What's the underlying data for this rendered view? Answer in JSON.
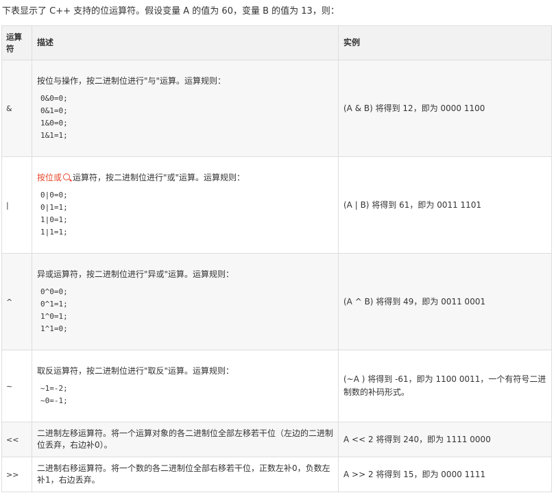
{
  "intro": "下表显示了 C++ 支持的位运算符。假设变量 A 的值为 60，变量 B 的值为 13，则：",
  "headers": {
    "operator": "运算符",
    "description": "描述",
    "example": "实例"
  },
  "rows": [
    {
      "operator": "&",
      "description": "按位与操作，按二进制位进行\"与\"运算。运算规则：",
      "rules": [
        "0&0=0;",
        "0&1=0;",
        "1&0=0;",
        "1&1=1;"
      ],
      "example": "(A & B) 将得到 12，即为 0000 1100"
    },
    {
      "operator": "|",
      "link_text": "按位或",
      "description": "运算符，按二进制位进行\"或\"运算。运算规则：",
      "rules": [
        "0|0=0;",
        "0|1=1;",
        "1|0=1;",
        "1|1=1;"
      ],
      "example": "(A | B) 将得到 61，即为 0011 1101"
    },
    {
      "operator": "^",
      "description": "异或运算符，按二进制位进行\"异或\"运算。运算规则：",
      "rules": [
        "0^0=0;",
        "0^1=1;",
        "1^0=1;",
        "1^1=0;"
      ],
      "example": "(A ^ B) 将得到 49，即为 0011 0001"
    },
    {
      "operator": "~",
      "description": "取反运算符，按二进制位进行\"取反\"运算。运算规则：",
      "rules": [
        "~1=-2;",
        "~0=-1;"
      ],
      "example": "(~A ) 将得到 -61，即为 1100 0011，一个有符号二进制数的补码形式。"
    },
    {
      "operator": "<<",
      "description": "二进制左移运算符。将一个运算对象的各二进制位全部左移若干位（左边的二进制位丢弃，右边补0）。",
      "example": "A << 2 将得到 240，即为 1111 0000"
    },
    {
      "operator": ">>",
      "description": "二进制右移运算符。将一个数的各二进制位全部右移若干位，正数左补0，负数左补1，右边丢弃。",
      "example": "A >> 2 将得到 15，即为 0000 1111"
    }
  ],
  "icons": {
    "search": "search-icon"
  },
  "colors": {
    "link": "#e8462a",
    "header_bg": "#f2f2f2",
    "border": "#dddddd"
  }
}
